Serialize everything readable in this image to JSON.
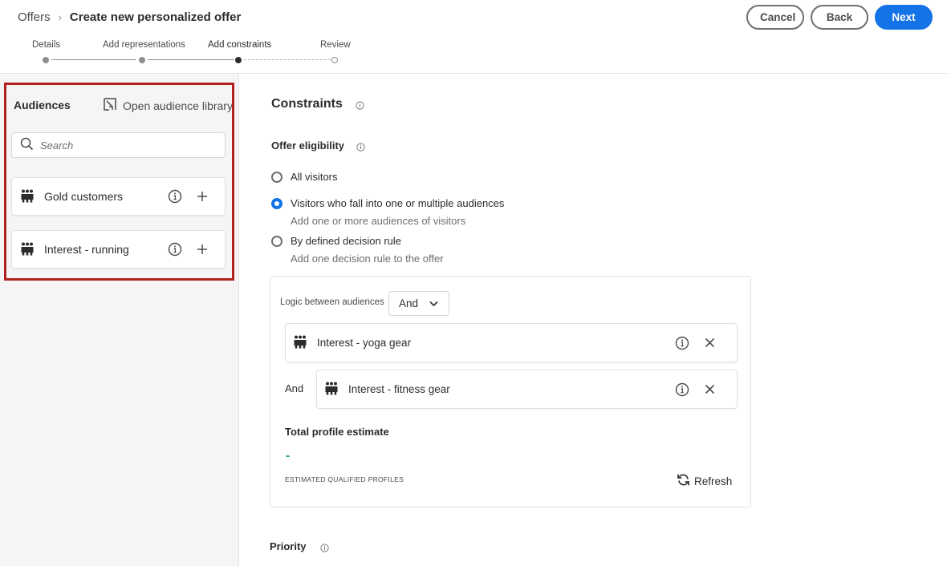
{
  "breadcrumb": {
    "root": "Offers",
    "current": "Create new personalized offer"
  },
  "actions": {
    "cancel": "Cancel",
    "back": "Back",
    "next": "Next"
  },
  "steps": [
    {
      "label": "Details",
      "state": "done"
    },
    {
      "label": "Add representations",
      "state": "done"
    },
    {
      "label": "Add constraints",
      "state": "current"
    },
    {
      "label": "Review",
      "state": "future"
    }
  ],
  "audiences_panel": {
    "title": "Audiences",
    "open_library": "Open audience library",
    "search_placeholder": "Search",
    "items": [
      {
        "name": "Gold customers"
      },
      {
        "name": "Interest - running"
      }
    ]
  },
  "constraints": {
    "title": "Constraints",
    "eligibility": {
      "title": "Offer eligibility",
      "options": [
        {
          "label": "All visitors",
          "sub": "",
          "checked": false
        },
        {
          "label": "Visitors who fall into one or multiple audiences",
          "sub": "Add one or more audiences of visitors",
          "checked": true
        },
        {
          "label": "By defined decision rule",
          "sub": "Add one decision rule to the offer",
          "checked": false
        }
      ]
    },
    "logic": {
      "label": "Logic between audiences",
      "value": "And",
      "selected": [
        {
          "name": "Interest - yoga gear"
        },
        {
          "operator": "And",
          "name": "Interest - fitness gear"
        }
      ]
    },
    "estimate": {
      "title": "Total profile estimate",
      "value": "-",
      "caption": "Estimated qualified profiles",
      "refresh": "Refresh"
    },
    "priority": "Priority"
  },
  "colors": {
    "accent": "#1473e6",
    "highlight": "#b3211e",
    "estimate": "#2d9d78"
  }
}
